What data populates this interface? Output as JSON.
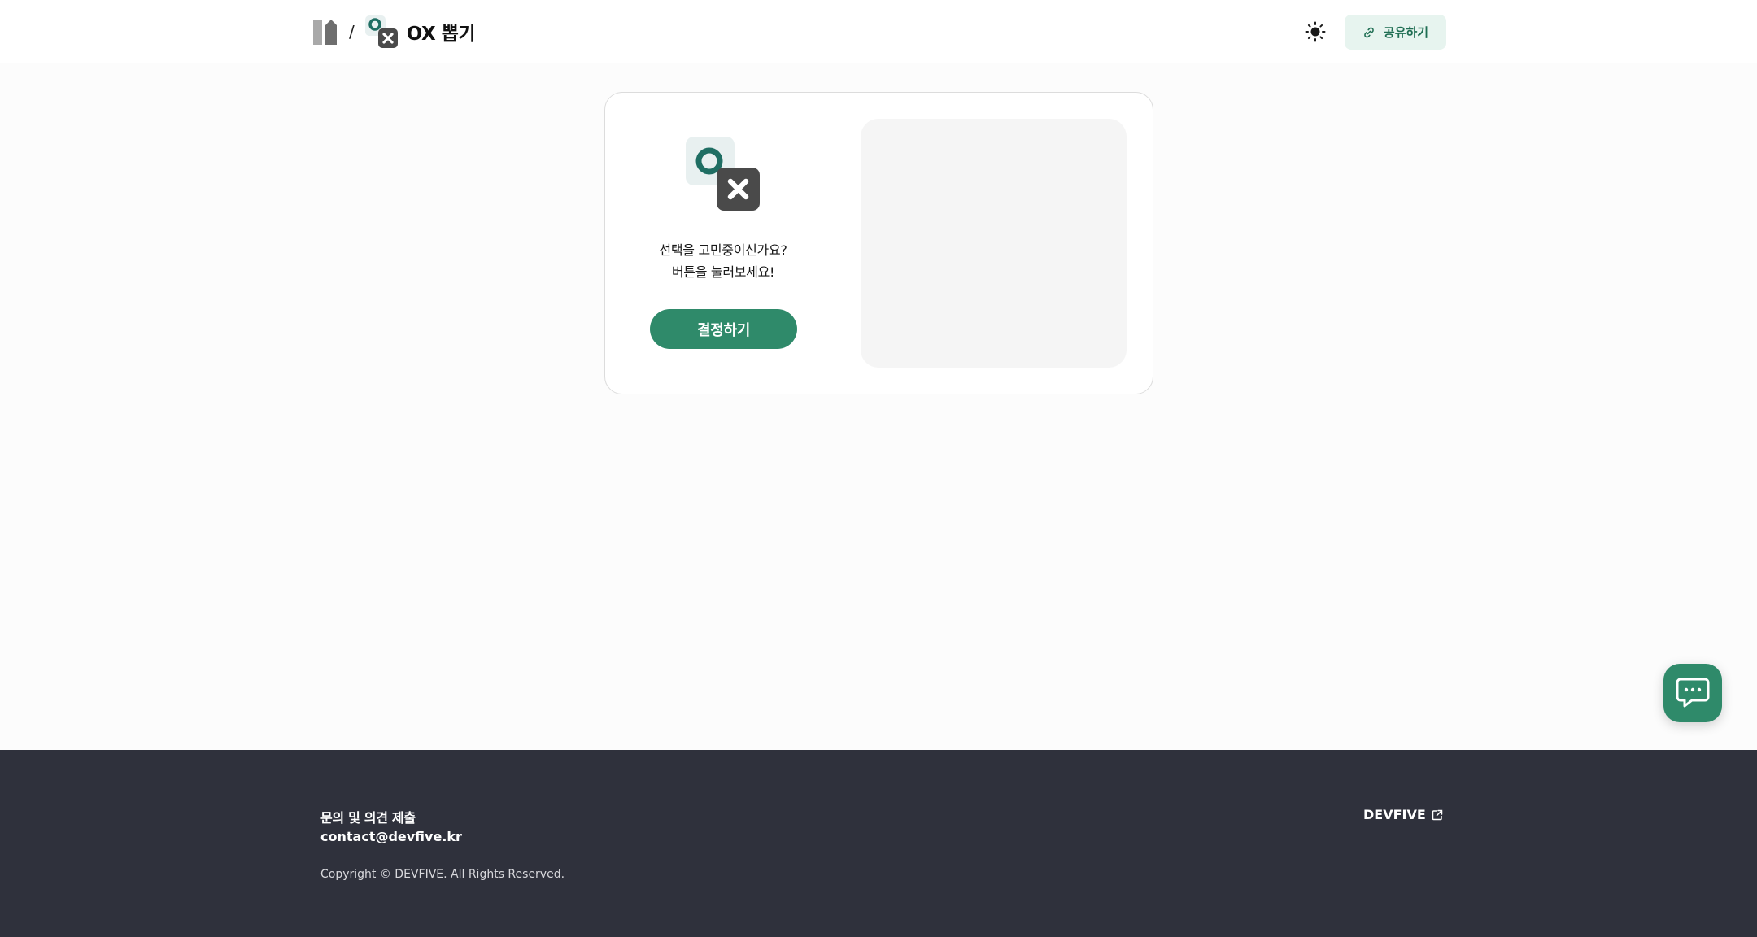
{
  "header": {
    "separator": "/",
    "app_title": "OX 뽑기",
    "share_label": "공유하기",
    "icons": {
      "logo": "devfive-logo",
      "app": "ox-icon",
      "theme": "sun-icon",
      "share": "link-icon"
    }
  },
  "card": {
    "prompt_line1": "선택을 고민중이신가요?",
    "prompt_line2": "버튼을 눌러보세요!",
    "decide_label": "결정하기"
  },
  "footer": {
    "inquiry": "문의 및 의견 제출",
    "email": "contact@devfive.kr",
    "copyright": "Copyright © DEVFIVE. All Rights Reserved.",
    "company_link": "DEVFIVE"
  },
  "colors": {
    "accent": "#2f8a6a",
    "accent_light": "#e7f4ef",
    "footer_bg": "#2f313c",
    "o_mark": "#1f6e63",
    "x_tile": "#4a4a4a"
  }
}
